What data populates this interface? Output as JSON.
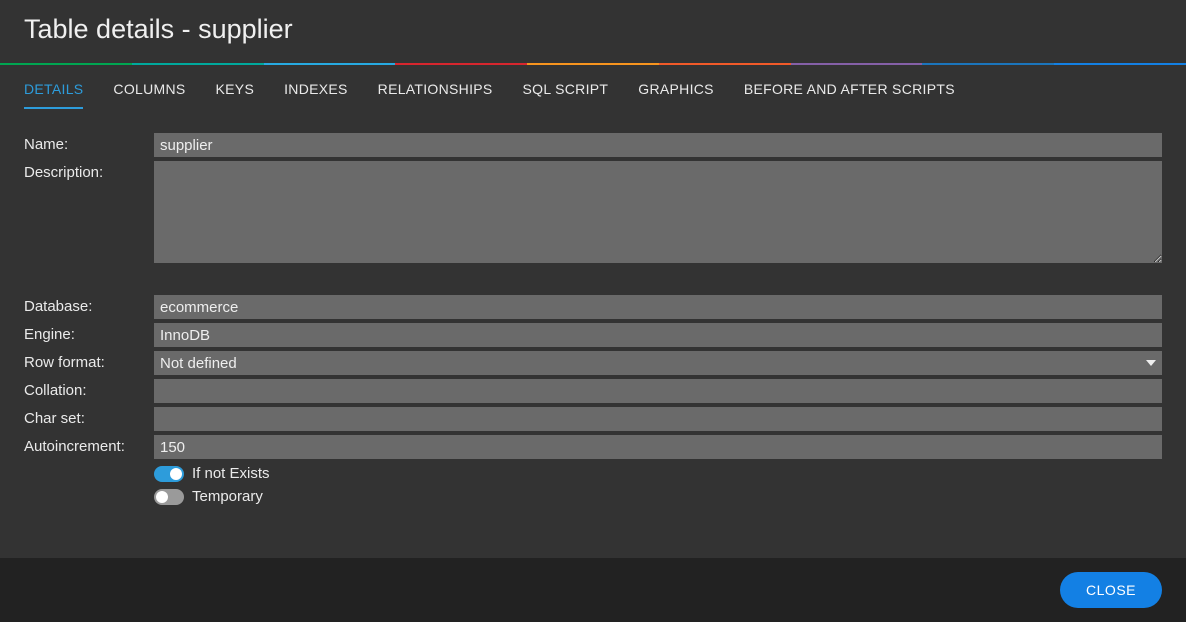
{
  "header": {
    "title": "Table details - supplier"
  },
  "tabs": [
    "DETAILS",
    "COLUMNS",
    "KEYS",
    "INDEXES",
    "RELATIONSHIPS",
    "SQL SCRIPT",
    "GRAPHICS",
    "BEFORE AND AFTER SCRIPTS"
  ],
  "active_tab": 0,
  "form": {
    "labels": {
      "name": "Name:",
      "description": "Description:",
      "database": "Database:",
      "engine": "Engine:",
      "row_format": "Row format:",
      "collation": "Collation:",
      "char_set": "Char set:",
      "autoincrement": "Autoincrement:"
    },
    "values": {
      "name": "supplier",
      "description": "",
      "database": "ecommerce",
      "engine": "InnoDB",
      "row_format": "Not defined",
      "collation": "",
      "char_set": "",
      "autoincrement": "150"
    },
    "toggles": {
      "if_not_exists": {
        "label": "If not Exists",
        "on": true
      },
      "temporary": {
        "label": "Temporary",
        "on": false
      }
    }
  },
  "footer": {
    "close": "CLOSE"
  },
  "color_bar": [
    "#00a651",
    "#00a99d",
    "#27aae1",
    "#d7262e",
    "#f7941e",
    "#f15a29",
    "#8560a8",
    "#1b75bc",
    "#1380e4"
  ]
}
